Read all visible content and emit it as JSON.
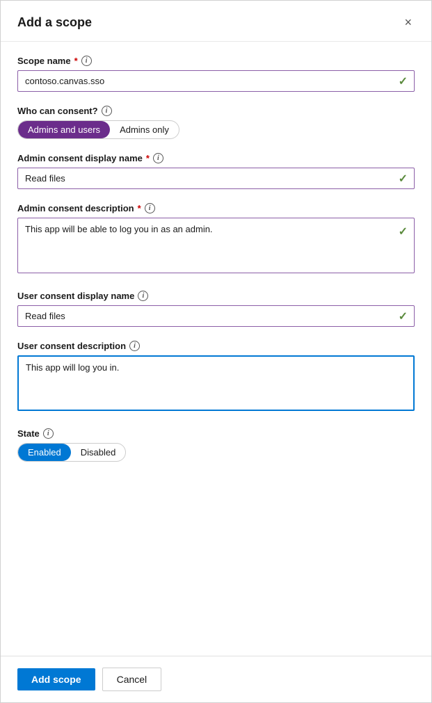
{
  "dialog": {
    "title": "Add a scope",
    "close_label": "×"
  },
  "form": {
    "scope_name_label": "Scope name",
    "scope_name_value": "contoso.canvas.sso",
    "scope_name_check": "✓",
    "who_can_consent_label": "Who can consent?",
    "consent_option_1": "Admins and users",
    "consent_option_2": "Admins only",
    "admin_consent_display_name_label": "Admin consent display name",
    "admin_consent_display_name_value": "Read files",
    "admin_consent_display_name_check": "✓",
    "admin_consent_description_label": "Admin consent description",
    "admin_consent_description_value": "This app will be able to log you in as an admin.",
    "admin_consent_description_check": "✓",
    "user_consent_display_name_label": "User consent display name",
    "user_consent_display_name_value": "Read files",
    "user_consent_display_name_check": "✓",
    "user_consent_description_label": "User consent description",
    "user_consent_description_value": "This app will log you in.",
    "state_label": "State",
    "state_option_1": "Enabled",
    "state_option_2": "Disabled"
  },
  "footer": {
    "add_scope_label": "Add scope",
    "cancel_label": "Cancel"
  },
  "icons": {
    "info": "i",
    "close": "✕",
    "check": "✓"
  }
}
